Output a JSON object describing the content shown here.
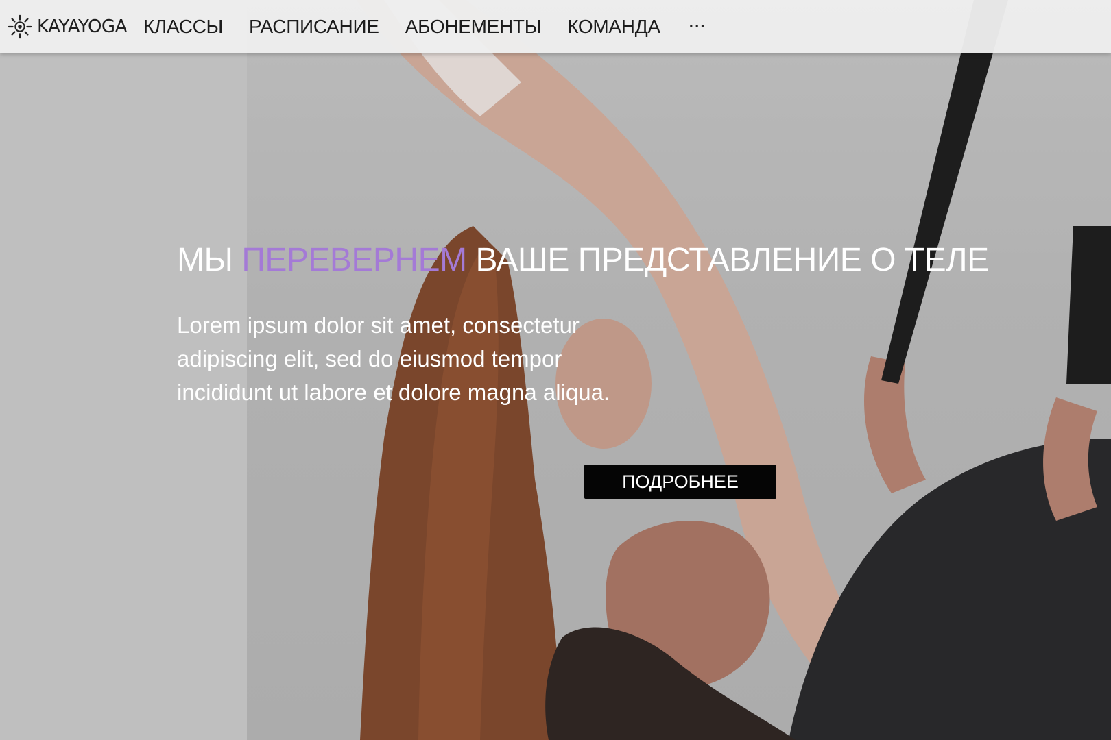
{
  "brand": {
    "name": "KAYAYOGA",
    "icon": "sun-mandala-logo"
  },
  "nav": {
    "items": [
      {
        "label": "КЛАССЫ"
      },
      {
        "label": "РАСПИСАНИЕ"
      },
      {
        "label": "АБОНЕМЕНТЫ"
      },
      {
        "label": "КОМАНДА"
      }
    ],
    "more_label": "···"
  },
  "hero": {
    "headline_start": "МЫ",
    "headline_accent": "ПЕРЕВЕРНЕМ",
    "headline_end": "ВАШЕ ПРЕДСТАВЛЕНИЕ О ТЕЛЕ",
    "lead": "Lorem ipsum dolor sit amet, consectetur adipiscing elit, sed do eiusmod tempor incididunt ut labore et dolore magna aliqua.",
    "cta_label": "ПОДРОБНЕЕ"
  },
  "colors": {
    "accent": "#a47ad6",
    "cta_background": "#050505",
    "navbar_background": "#eeeeee",
    "text_light": "#ffffff"
  }
}
